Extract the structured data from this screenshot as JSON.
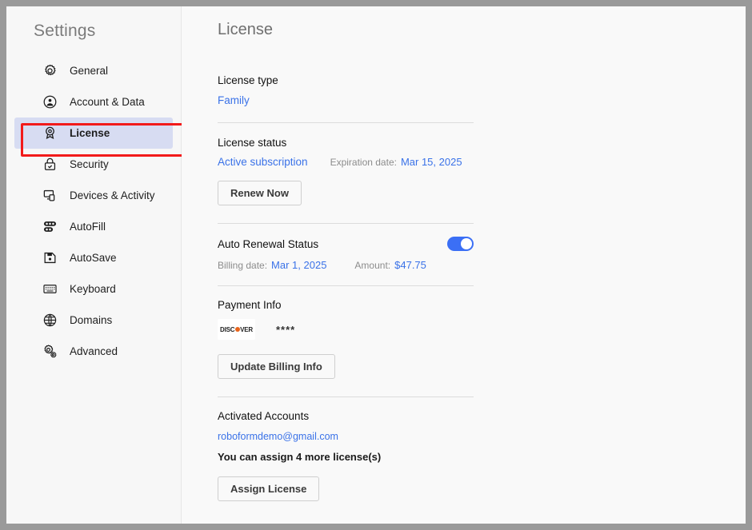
{
  "sidebar": {
    "title": "Settings",
    "items": [
      {
        "label": "General",
        "icon": "gear-icon"
      },
      {
        "label": "Account & Data",
        "icon": "account-circle-icon"
      },
      {
        "label": "License",
        "icon": "license-badge-icon"
      },
      {
        "label": "Security",
        "icon": "lock-check-icon"
      },
      {
        "label": "Devices & Activity",
        "icon": "devices-icon"
      },
      {
        "label": "AutoFill",
        "icon": "autofill-toggles-icon"
      },
      {
        "label": "AutoSave",
        "icon": "floppy-disk-icon"
      },
      {
        "label": "Keyboard",
        "icon": "keyboard-icon"
      },
      {
        "label": "Domains",
        "icon": "globe-icon"
      },
      {
        "label": "Advanced",
        "icon": "gears-icon"
      }
    ],
    "selected": "License"
  },
  "main": {
    "title": "License",
    "license_type": {
      "heading": "License type",
      "value": "Family"
    },
    "license_status": {
      "heading": "License status",
      "status": "Active subscription",
      "expiration_label": "Expiration date:",
      "expiration_value": "Mar 15, 2025",
      "renew_button": "Renew Now"
    },
    "auto_renewal": {
      "heading": "Auto Renewal Status",
      "toggle_state": "on",
      "billing_label": "Billing date:",
      "billing_value": "Mar 1, 2025",
      "amount_label": "Amount:",
      "amount_value": "$47.75"
    },
    "payment_info": {
      "heading": "Payment Info",
      "card_brand": "DISCOVER",
      "card_mask": "****",
      "update_button": "Update Billing Info"
    },
    "activated_accounts": {
      "heading": "Activated Accounts",
      "email": "roboformdemo@gmail.com",
      "assign_note": "You can assign 4 more license(s)",
      "assign_button": "Assign License"
    }
  },
  "colors": {
    "accent_blue": "#3a72e8",
    "toggle_on": "#3b6ff5",
    "highlight_red": "#f21a1a",
    "selected_bg": "#d7dcf2",
    "discover_orange": "#e8641c"
  }
}
